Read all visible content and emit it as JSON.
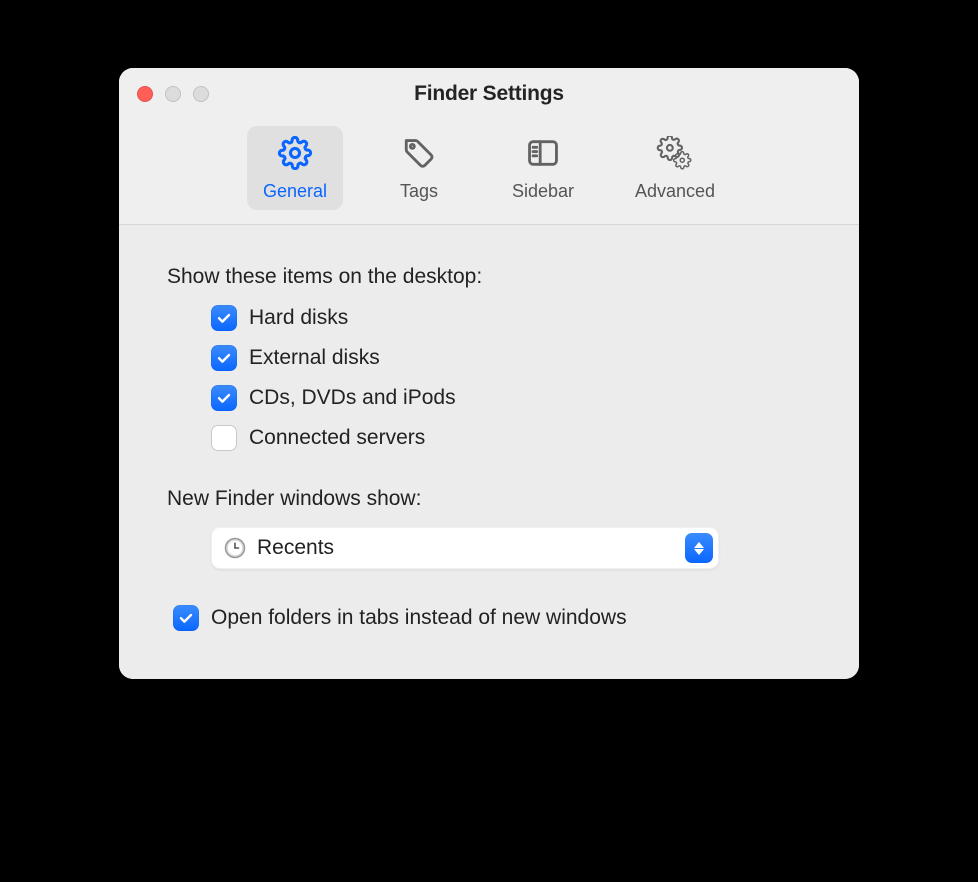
{
  "window": {
    "title": "Finder Settings"
  },
  "tabs": [
    {
      "label": "General",
      "active": true
    },
    {
      "label": "Tags",
      "active": false
    },
    {
      "label": "Sidebar",
      "active": false
    },
    {
      "label": "Advanced",
      "active": false
    }
  ],
  "section_desktop": {
    "label": "Show these items on the desktop:",
    "items": [
      {
        "label": "Hard disks",
        "checked": true
      },
      {
        "label": "External disks",
        "checked": true
      },
      {
        "label": "CDs, DVDs and iPods",
        "checked": true
      },
      {
        "label": "Connected servers",
        "checked": false
      }
    ]
  },
  "section_newwin": {
    "label": "New Finder windows show:",
    "selected": "Recents"
  },
  "open_in_tabs": {
    "label": "Open folders in tabs instead of new windows",
    "checked": true
  }
}
